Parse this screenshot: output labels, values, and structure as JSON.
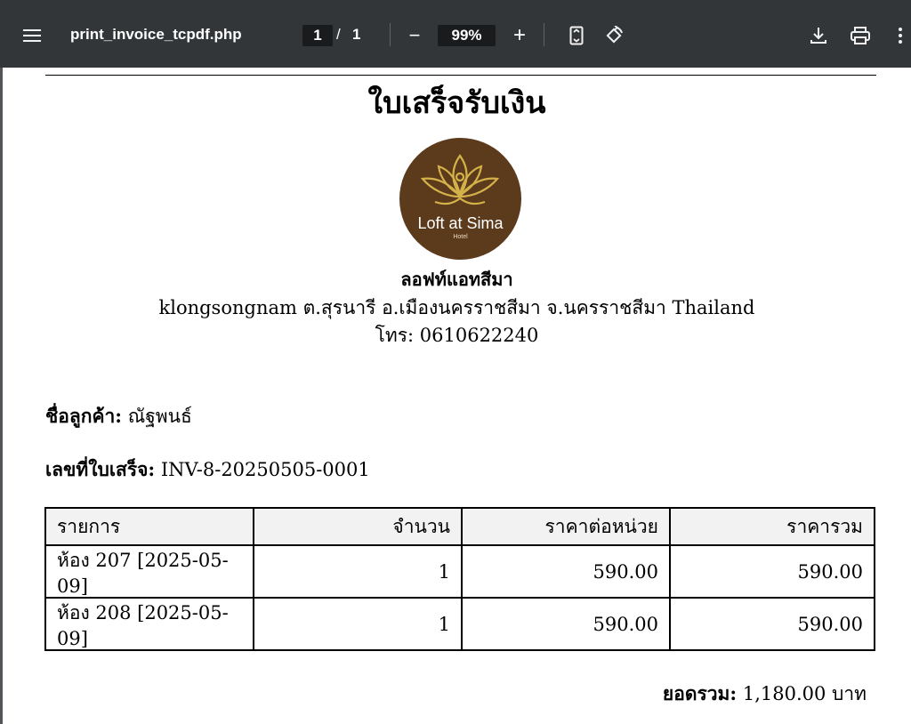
{
  "toolbar": {
    "menu_icon": "menu-icon",
    "filename": "print_invoice_tcpdf.php",
    "page_current": "1",
    "page_separator": "/",
    "page_total": "1",
    "zoom_out": "−",
    "zoom_level": "99%",
    "zoom_in": "+",
    "icons": [
      "fit-page-icon",
      "rotate-icon",
      "download-icon",
      "print-icon",
      "more-vert-icon"
    ]
  },
  "document": {
    "title": "ใบเสร็จรับเงิน",
    "logo": {
      "name": "Loft at Sima",
      "sub": "Hotel",
      "bg_color": "#5c3a1c",
      "gold_color": "#d4b24a"
    },
    "company_name": "ลอฟท์แอทสีมา",
    "address": "klongsongnam ต.สุรนารี อ.เมืองนครราชสีมา จ.นครราชสีมา Thailand",
    "phone": "โทร: 0610622240",
    "customer_label": "ชื่อลูกค้า:",
    "customer_name": "ณัฐพนธ์",
    "invoice_label": "เลขที่ใบเสร็จ:",
    "invoice_no": "INV-8-20250505-0001",
    "table": {
      "headers": [
        "รายการ",
        "จำนวน",
        "ราคาต่อหน่วย",
        "ราคารวม"
      ],
      "rows": [
        [
          "ห้อง 207 [2025-05-09]",
          "1",
          "590.00",
          "590.00"
        ],
        [
          "ห้อง 208 [2025-05-09]",
          "1",
          "590.00",
          "590.00"
        ]
      ]
    },
    "total_label": "ยอดรวม:",
    "total_value": "1,180.00 บาท"
  }
}
